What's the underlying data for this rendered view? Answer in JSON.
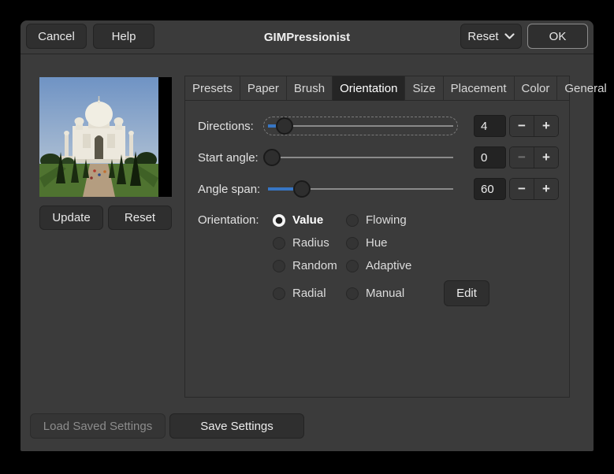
{
  "window": {
    "title": "GIMPressionist"
  },
  "header": {
    "cancel": "Cancel",
    "help": "Help",
    "reset": "Reset",
    "ok": "OK"
  },
  "preview": {
    "update": "Update",
    "reset": "Reset"
  },
  "tabs": [
    {
      "label": "Presets",
      "active": false
    },
    {
      "label": "Paper",
      "active": false
    },
    {
      "label": "Brush",
      "active": false
    },
    {
      "label": "Orientation",
      "active": true
    },
    {
      "label": "Size",
      "active": false
    },
    {
      "label": "Placement",
      "active": false
    },
    {
      "label": "Color",
      "active": false
    },
    {
      "label": "General",
      "active": false
    }
  ],
  "orientation": {
    "sliders": [
      {
        "label": "Directions:",
        "value": "4",
        "percent": 7,
        "focused": true,
        "minus_disabled": false
      },
      {
        "label": "Start angle:",
        "value": "0",
        "percent": 0,
        "focused": false,
        "minus_disabled": true
      },
      {
        "label": "Angle span:",
        "value": "60",
        "percent": 17,
        "focused": false,
        "minus_disabled": false
      }
    ],
    "group_label": "Orientation:",
    "radios": [
      {
        "label": "Value",
        "checked": true
      },
      {
        "label": "Flowing",
        "checked": false
      },
      {
        "label": "Radius",
        "checked": false
      },
      {
        "label": "Hue",
        "checked": false
      },
      {
        "label": "Random",
        "checked": false
      },
      {
        "label": "Adaptive",
        "checked": false
      },
      {
        "label": "Radial",
        "checked": false
      },
      {
        "label": "Manual",
        "checked": false
      }
    ],
    "edit": "Edit",
    "icons": {
      "minus": "−",
      "plus": "+"
    }
  },
  "footer": {
    "load": "Load Saved Settings",
    "load_disabled": true,
    "save": "Save Settings"
  },
  "colors": {
    "accent_blue": "#3776c4",
    "dialog_bg": "#3b3b3b",
    "entry_bg": "#232323",
    "active_tab_bg": "#252525"
  }
}
